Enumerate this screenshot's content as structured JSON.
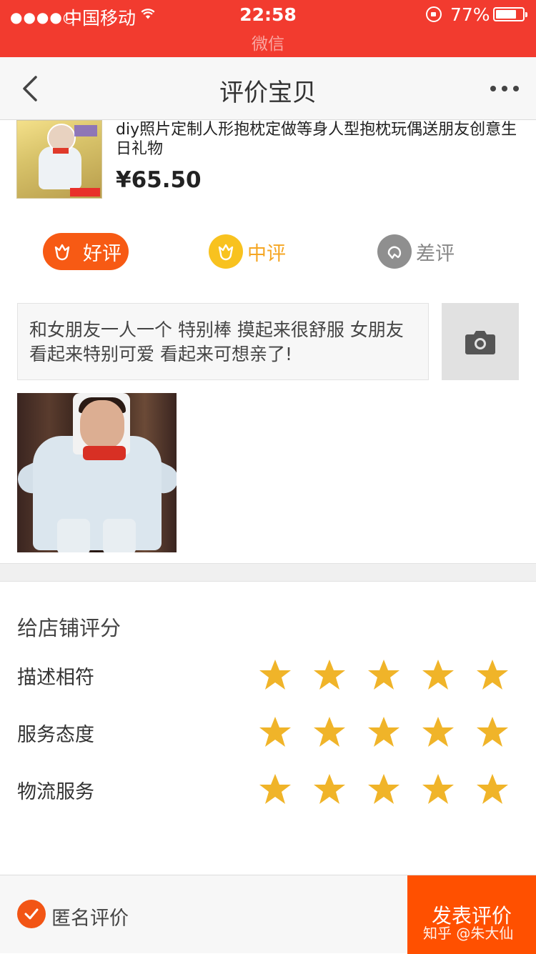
{
  "status_bar": {
    "signal": "●●●●○",
    "carrier": "中国移动",
    "time": "22:58",
    "battery_percent": "77%",
    "battery_level": 0.77,
    "return_app": "微信"
  },
  "nav": {
    "title": "评价宝贝",
    "back_icon": "chevron-left-icon",
    "more_icon": "more-dots-icon"
  },
  "product": {
    "name": "diy照片定制人形抱枕定做等身人型抱枕玩偶送朋友创意生日礼物",
    "price": "¥65.50"
  },
  "rating": {
    "good": "好评",
    "medium": "中评",
    "bad": "差评",
    "selected": "good"
  },
  "review": {
    "text": "和女朋友一人一个 特别棒 摸起来很舒服 女朋友看起来特别可爱  看起来可想亲了!"
  },
  "shop_rating": {
    "title": "给店铺评分",
    "items": [
      {
        "label": "描述相符",
        "stars": 5
      },
      {
        "label": "服务态度",
        "stars": 5
      },
      {
        "label": "物流服务",
        "stars": 5
      }
    ]
  },
  "bottom": {
    "anonymous_label": "匿名评价",
    "anonymous_checked": true,
    "submit_label": "发表评价",
    "watermark": "知乎 @朱大仙"
  },
  "colors": {
    "status_bar": "#f23b2f",
    "accent": "#ff5000",
    "star": "#f0b429",
    "medium": "#f8c21f"
  }
}
